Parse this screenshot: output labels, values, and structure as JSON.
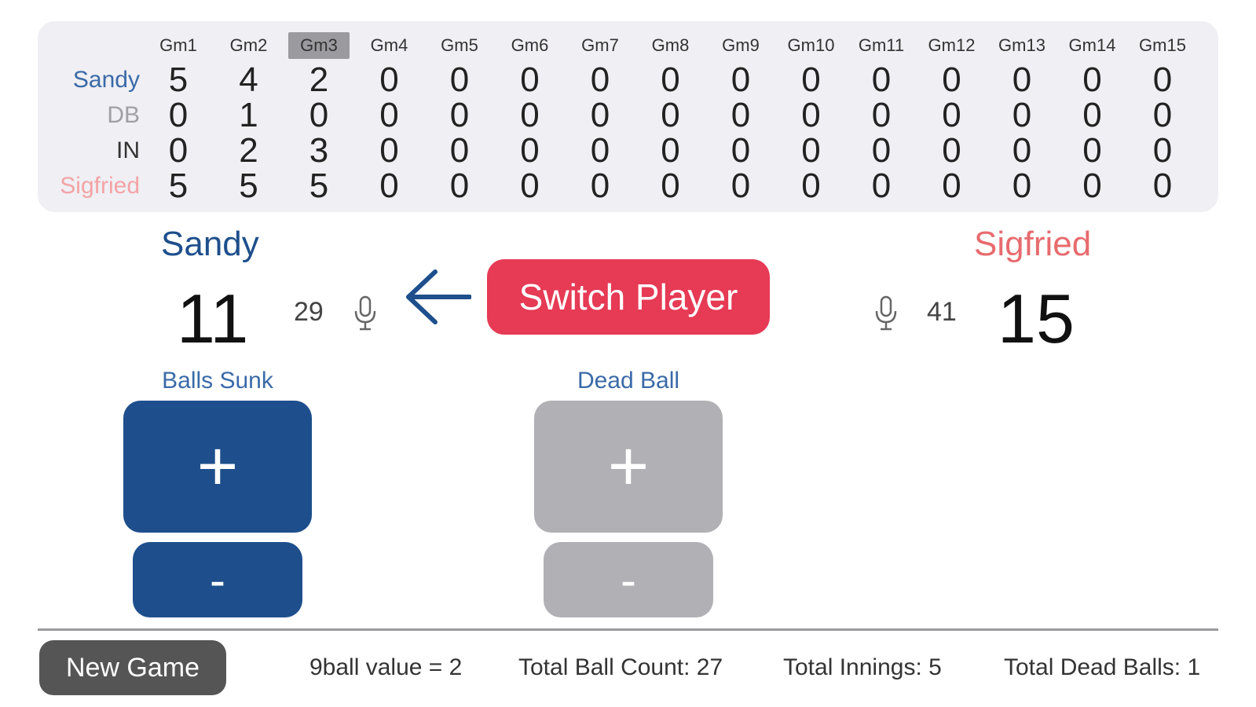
{
  "scoreboard": {
    "headers": [
      "Gm1",
      "Gm2",
      "Gm3",
      "Gm4",
      "Gm5",
      "Gm6",
      "Gm7",
      "Gm8",
      "Gm9",
      "Gm10",
      "Gm11",
      "Gm12",
      "Gm13",
      "Gm14",
      "Gm15"
    ],
    "selected_header_index": 2,
    "rows": [
      {
        "label": "Sandy",
        "color": "#3a6aa8",
        "values": [
          "5",
          "4",
          "2",
          "0",
          "0",
          "0",
          "0",
          "0",
          "0",
          "0",
          "0",
          "0",
          "0",
          "0",
          "0"
        ]
      },
      {
        "label": "DB",
        "color": "#a0a0a5",
        "values": [
          "0",
          "1",
          "0",
          "0",
          "0",
          "0",
          "0",
          "0",
          "0",
          "0",
          "0",
          "0",
          "0",
          "0",
          "0"
        ]
      },
      {
        "label": "IN",
        "color": "#333333",
        "values": [
          "0",
          "2",
          "3",
          "0",
          "0",
          "0",
          "0",
          "0",
          "0",
          "0",
          "0",
          "0",
          "0",
          "0",
          "0"
        ]
      },
      {
        "label": "Sigfried",
        "color": "#f4a3a5",
        "values": [
          "5",
          "5",
          "5",
          "0",
          "0",
          "0",
          "0",
          "0",
          "0",
          "0",
          "0",
          "0",
          "0",
          "0",
          "0"
        ]
      }
    ]
  },
  "left_player": {
    "name": "Sandy",
    "score": "11",
    "count": "29"
  },
  "right_player": {
    "name": "Sigfried",
    "score": "15",
    "count": "41"
  },
  "switch_button": "Switch Player",
  "labels": {
    "balls_sunk": "Balls Sunk",
    "dead_ball": "Dead Ball"
  },
  "buttons": {
    "plus": "+",
    "minus": "-"
  },
  "footer": {
    "new_game": "New Game",
    "nine_ball_value": "9ball value = 2",
    "total_ball_count": "Total Ball Count: 27",
    "total_innings": "Total Innings:  5",
    "total_dead_balls": "Total Dead Balls:  1"
  },
  "colors": {
    "blue": "#1e4f8c",
    "red": "#e63a55",
    "gray": "#b0b0b5",
    "dark_gray": "#555555"
  }
}
